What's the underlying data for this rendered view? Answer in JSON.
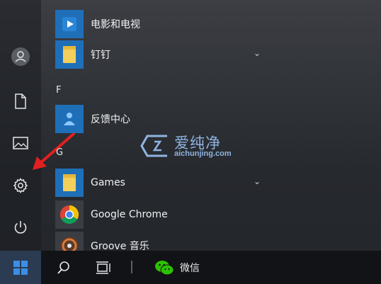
{
  "start_menu": {
    "apps": [
      {
        "label": "电影和电视",
        "icon": "movies-tv-icon",
        "has_chevron": false
      },
      {
        "label": "钉钉",
        "icon": "folder-icon",
        "has_chevron": true
      },
      {
        "label": "反馈中心",
        "icon": "feedback-hub-icon",
        "has_chevron": false
      },
      {
        "label": "Games",
        "icon": "folder-icon",
        "has_chevron": true
      },
      {
        "label": "Google Chrome",
        "icon": "chrome-icon",
        "has_chevron": false
      },
      {
        "label": "Groove 音乐",
        "icon": "groove-music-icon",
        "has_chevron": false
      }
    ],
    "letters": [
      "F",
      "G"
    ],
    "chevron": "⌄"
  },
  "rail": {
    "icons": [
      "user-icon",
      "documents-icon",
      "pictures-icon",
      "settings-icon",
      "power-icon"
    ]
  },
  "watermark": {
    "text": "爱纯净",
    "url": "aichunjing.com"
  },
  "taskbar": {
    "wechat_label": "微信",
    "icons": [
      "windows-start-icon",
      "search-icon",
      "task-view-icon",
      "wechat-icon"
    ]
  },
  "colors": {
    "tile_blue": "#1f6fb8",
    "folder_yellow": "#f3cf5b",
    "arrow_red": "#e02020",
    "taskbar": "#111316"
  }
}
